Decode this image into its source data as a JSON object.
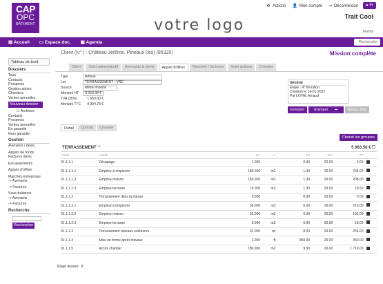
{
  "header": {
    "logo_line1": "CAP",
    "logo_line2": "OPC",
    "logo_line3": "BÂTIMENT",
    "brand": "votre logo",
    "links": [
      "Actions",
      "Mon compte",
      "Déconnexion"
    ],
    "lang": "Fr",
    "company": "Trait Cool",
    "user": "Jérémy"
  },
  "nav": {
    "items": [
      "Accueil",
      "Espace doc.",
      "Agenda"
    ],
    "search": "Recherche"
  },
  "sidebar": {
    "dashboard": "Tableau de bord",
    "dossiers_head": "Dossiers",
    "dossiers": [
      "Tous",
      "Contacts",
      "Prospects",
      "Gestion admin",
      "Chantiers",
      "Ventes annuelles"
    ],
    "new_btn": "Nouveau dossier",
    "archives": "Archives",
    "archive_items": [
      "Contacts",
      "Prospects",
      "Ventes annuelles",
      "En garantie",
      "Hors garantie"
    ],
    "gestion_head": "Gestion",
    "gestion": [
      "Avenants / devis",
      "Appels de fonds",
      "Factures devis",
      "Encaissements",
      "Appels d'offres",
      "Marchés entreprises",
      "-> Avenants",
      "-> Factures",
      "Sous-traitance",
      "-> Avenants",
      "-> Factures"
    ],
    "search_head": "Recherche",
    "search_btn": "Rechercher"
  },
  "main": {
    "client": "Client (N° ) : Château Jérôme, Pineaux (les) (85320)",
    "mission": "Mission complète",
    "tabs": [
      "Client",
      "Suivi administratif",
      "Avenants & devis",
      "Appel d'offres",
      "Marchés / factures",
      "Suivi actions",
      "Chantier"
    ],
    "active_tab": 3,
    "form": {
      "type_label": "Type",
      "type_val": "Artisan",
      "lot_label": "Lot",
      "lot_val": "TERRASSEMENT - VRD",
      "source_label": "Source",
      "source_val": "Métré Importé",
      "montant_ht_label": "Montant HT",
      "montant_ht_val": "8 253.98 €",
      "tva_label": "TVA (20%)",
      "tva_val": "1 650.80 €",
      "ttc_label": "Montant TTC",
      "ttc_val": "9 904.78 €"
    },
    "general": {
      "title": "Général",
      "etape": "Étape : 4° Brouillon",
      "creation": "Création le 14-01-2022",
      "par": "Par LOYAL Arnaud"
    },
    "buttons": [
      "Envoyer",
      "Envoyer",
      "Retour liste"
    ],
    "subtabs": [
      "Détail",
      "Contrat",
      "Chantier"
    ],
    "group_btn": "Choisir les groupes",
    "section": "TERRASSEMENT",
    "section_total": "5 063.50 €",
    "columns": [
      "Article",
      "Libellé",
      "QT",
      "U",
      "PU",
      "TVA",
      "PT"
    ],
    "rows": [
      [
        "01.1.1.1",
        "Décapage",
        "1.000",
        "",
        "0.00",
        "20.00",
        "0.00"
      ],
      [
        "01.1.1.1.1",
        "Emprise à empierrer",
        "180.000",
        "m2",
        "1.30",
        "20.00",
        "234.00"
      ],
      [
        "01.1.1.1.2",
        "Emprise maison",
        "160.000",
        "m2",
        "1.30",
        "20.00",
        "208.00"
      ],
      [
        "01.1.1.1.3",
        "Emprise terrasse",
        "15.000",
        "m2",
        "1.30",
        "20.00",
        "19.50"
      ],
      [
        "01.1.1.2",
        "Terrassement dans la masse",
        "0.000",
        "",
        "0.00",
        "20.00",
        "0.00"
      ],
      [
        "01.1.1.2.1",
        "Emprise à empierrer",
        "36.000",
        "m3",
        "6.00",
        "20.00",
        "216.00"
      ],
      [
        "01.1.1.2.2",
        "Emprise maison",
        "32.000",
        "m3",
        "6.00",
        "20.00",
        "192.00"
      ],
      [
        "01.1.1.2.3",
        "Emprise terrasse",
        "3.000",
        "m3",
        "6.00",
        "20.00",
        "18.00"
      ],
      [
        "01.1.1.3",
        "Terrassement réseaux extérieurs",
        "32.000",
        "ml",
        "8.00",
        "20.00",
        "256.00"
      ],
      [
        "01.1.1.4",
        "Mise en forme après travaux",
        "1.000",
        "ft",
        "350.00",
        "20.00",
        "350.00"
      ],
      [
        "01.1.1.5",
        "Accès chantier",
        "180.000",
        "m2",
        "9.50",
        "20.00",
        "1 710.00"
      ]
    ],
    "footer": "Étape dossier : 8"
  }
}
